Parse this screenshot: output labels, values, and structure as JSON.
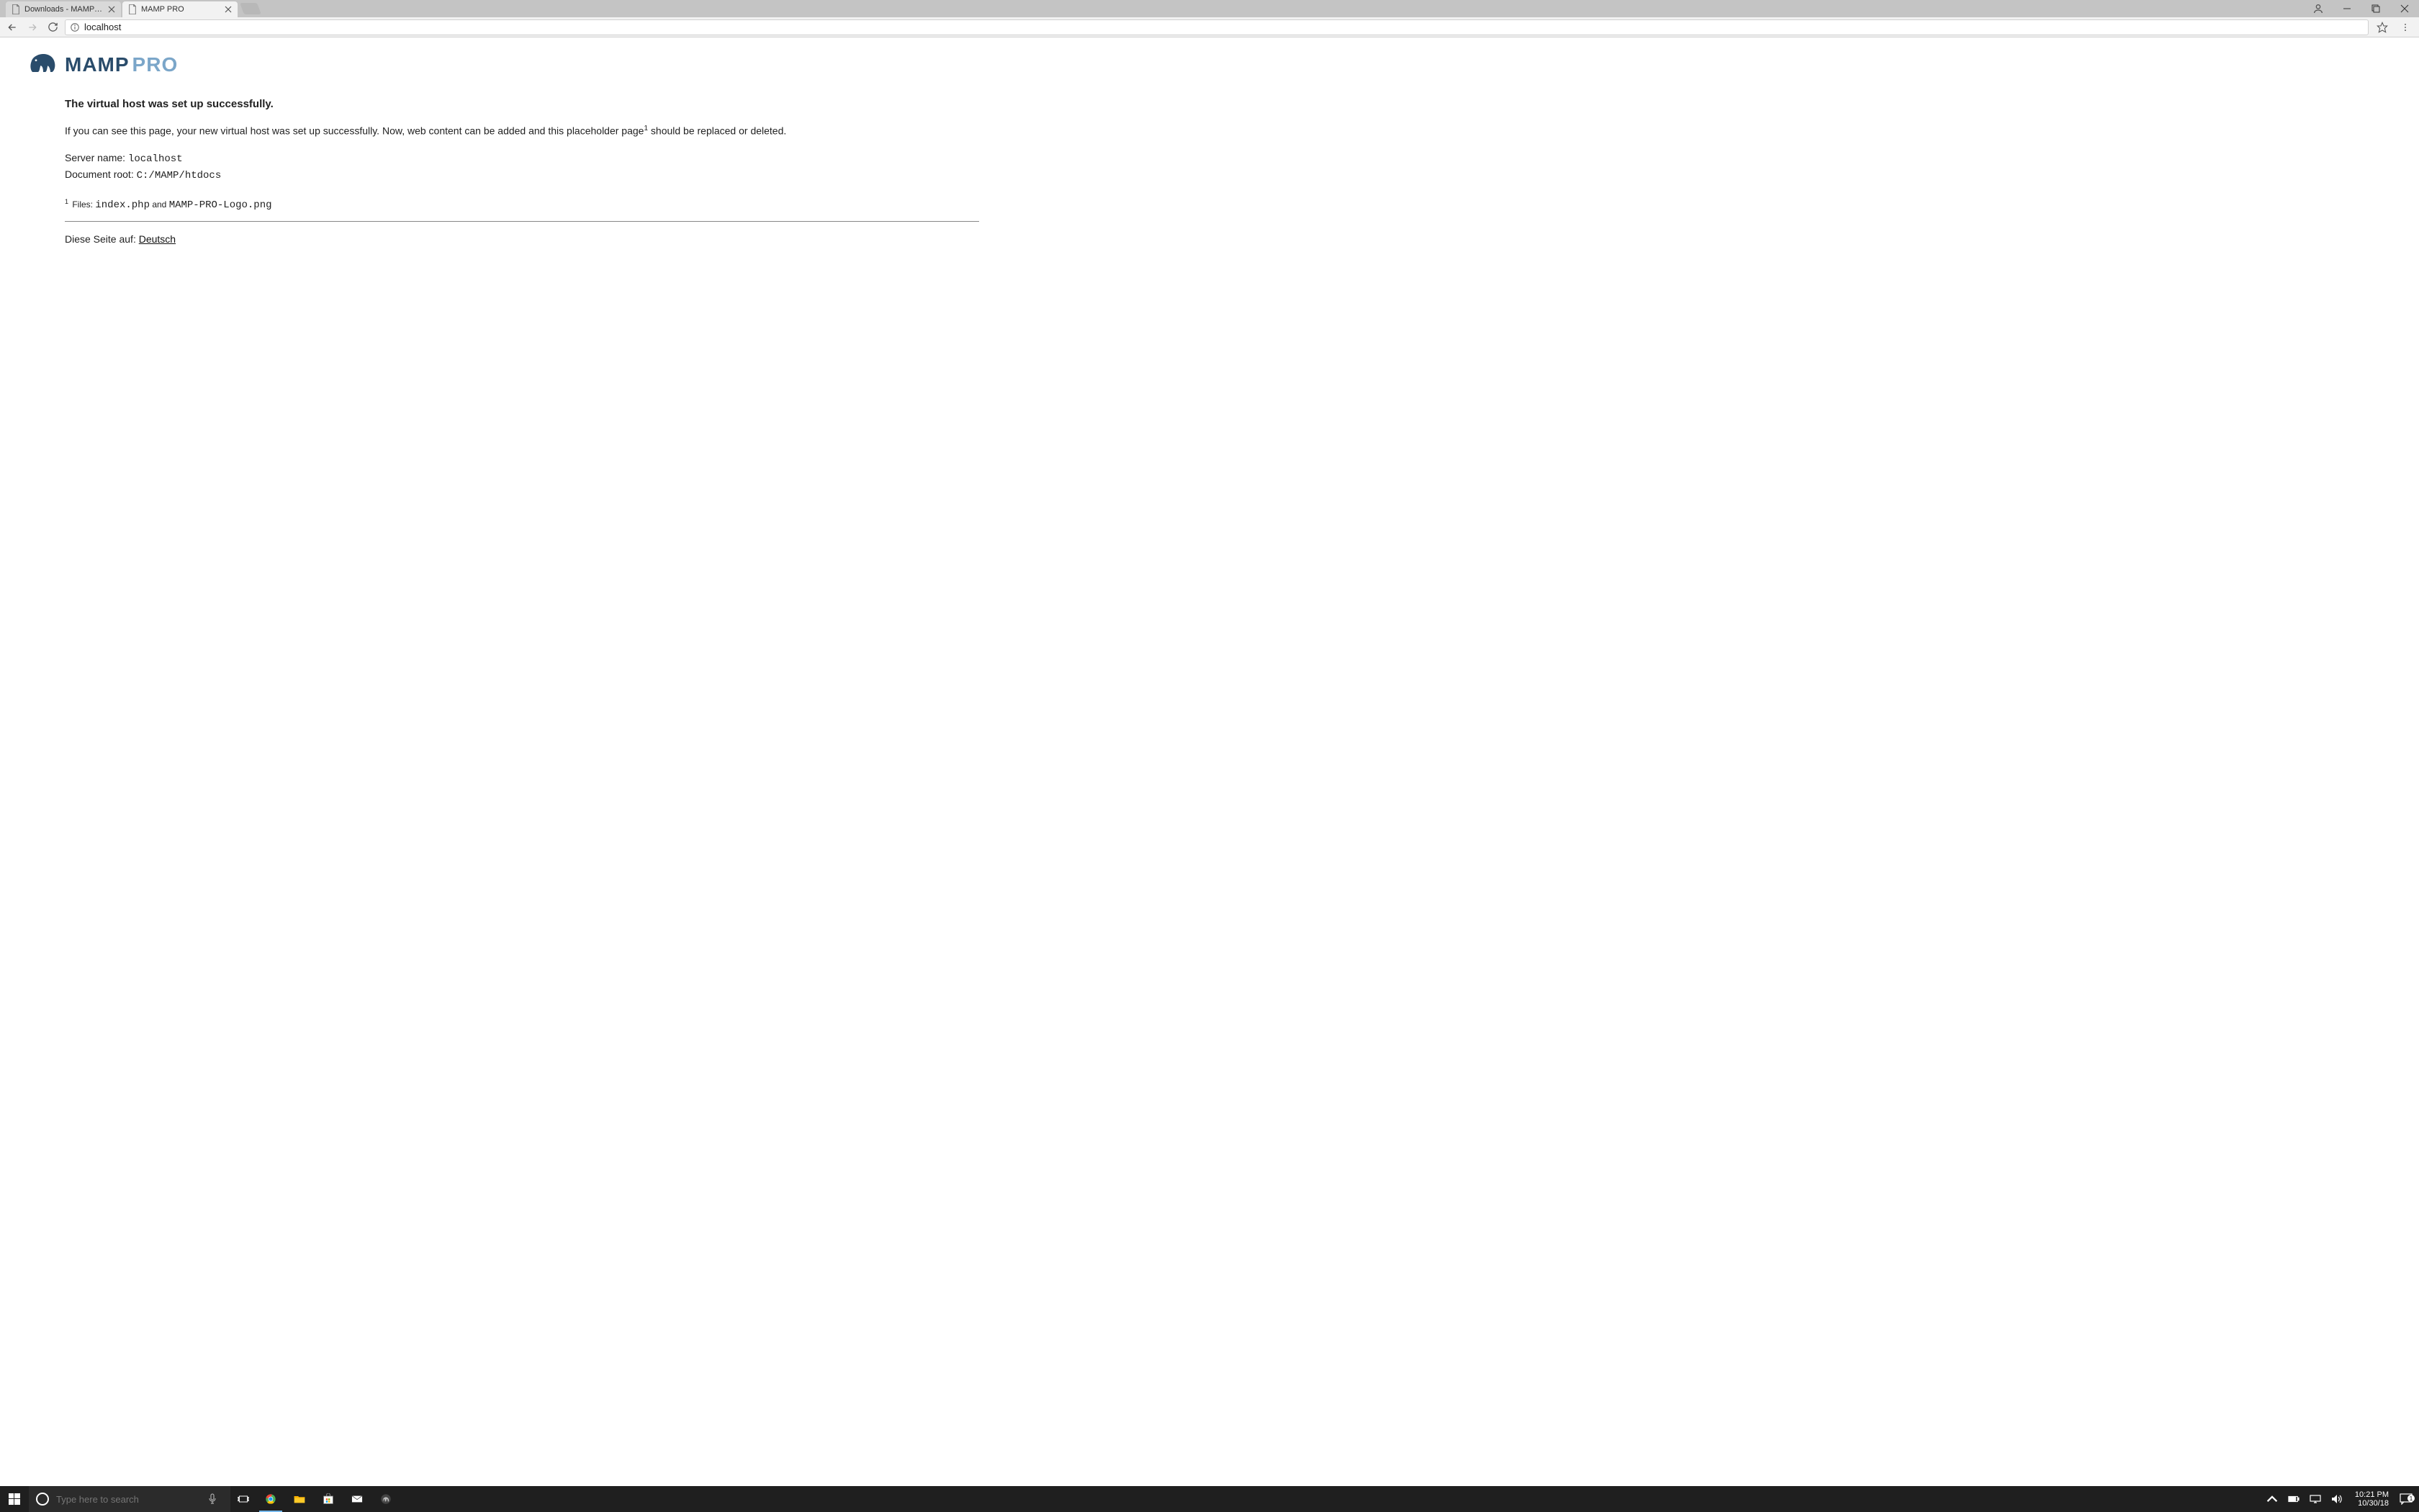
{
  "browser": {
    "tabs": [
      {
        "title": "Downloads - MAMP & M",
        "active": false
      },
      {
        "title": "MAMP PRO",
        "active": true
      }
    ],
    "url": "localhost"
  },
  "page": {
    "logo": {
      "text_main": "MAMP",
      "text_sub": "PRO"
    },
    "heading": "The virtual host was set up successfully.",
    "paragraph_before_sup": "If you can see this page, your new virtual host was set up successfully. Now, web content can be added and this placeholder page",
    "paragraph_sup": "1",
    "paragraph_after_sup": " should be replaced or deleted.",
    "server_name_label": "Server name: ",
    "server_name_value": "localhost",
    "doc_root_label": "Document root: ",
    "doc_root_value": "C:/MAMP/htdocs",
    "footnote_sup": "1",
    "footnote_before": " Files: ",
    "footnote_file1": "index.php",
    "footnote_mid": " and ",
    "footnote_file2": "MAMP-PRO-Logo.png",
    "lang_label": "Diese Seite auf: ",
    "lang_link": "Deutsch"
  },
  "taskbar": {
    "search_placeholder": "Type here to search",
    "time": "10:21 PM",
    "date": "10/30/18",
    "notification_count": "1"
  }
}
